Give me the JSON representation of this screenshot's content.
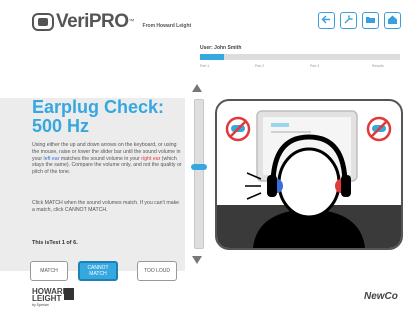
{
  "brand": {
    "name": "VeriPRO",
    "tm": "™",
    "from": "From Howard Leight"
  },
  "user": {
    "label": "User: John Smith"
  },
  "progress": {
    "fraction": 0.12,
    "steps": [
      "Part 1",
      "Part 2",
      "Part 3",
      "Results"
    ]
  },
  "nav": {
    "icons": [
      "back-arrow-icon",
      "tools-icon",
      "folder-icon",
      "home-icon"
    ]
  },
  "check": {
    "title_line1": "Earplug Check:",
    "title_line2": "500 Hz",
    "instr_a": "Using either the up and down arrows on the keyboard, or using the mouse, raise or lower the slider bar until the sound volume in your ",
    "left_ear": "left ear",
    "instr_b": " matches the sound volume in your ",
    "right_ear": "right ear",
    "instr_c": " (which stays the same). Compare the volume only, and not the quality or pitch of the tone.",
    "instr2": "Click MATCH when the sound volumes match. If you can't make a match, click CANNOT MATCH.",
    "test_count": "This isTest 1 of 6."
  },
  "buttons": {
    "match": "MATCH",
    "cannot_match": "CANNOT MATCH",
    "too_loud": "TOO LOUD"
  },
  "slider": {
    "level": 0.55
  },
  "footer": {
    "howard_leight_1": "HOWARD",
    "howard_leight_2": "LEIGHT",
    "sperian": "by Sperian",
    "newco": "NewCo"
  },
  "colors": {
    "accent": "#35a8e0",
    "left_ear": "#3b6fd8",
    "right_ear": "#e03a3a"
  }
}
